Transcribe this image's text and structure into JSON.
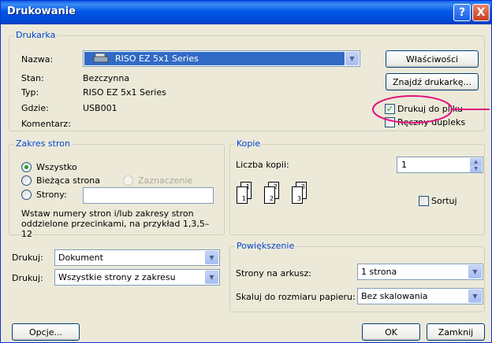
{
  "window": {
    "title": "Drukowanie",
    "help_label": "?",
    "close_label": "X"
  },
  "printer": {
    "group_label": "Drukarka",
    "name_label": "Nazwa:",
    "name_value": "RISO EZ 5x1 Series",
    "status_label": "Stan:",
    "status_value": "Bezczynna",
    "type_label": "Typ:",
    "type_value": "RISO EZ 5x1 Series",
    "where_label": "Gdzie:",
    "where_value": "USB001",
    "comment_label": "Komentarz:",
    "properties_button": "Właściwości",
    "find_button": "Znajdź drukarkę...",
    "print_to_file_label": "Drukuj do pliku",
    "print_to_file_checked": true,
    "manual_duplex_label": "Ręczny dupleks",
    "manual_duplex_checked": false
  },
  "page_range": {
    "group_label": "Zakres stron",
    "all_label": "Wszystko",
    "current_label": "Bieżąca strona",
    "selection_label": "Zaznaczenie",
    "pages_label": "Strony:",
    "pages_value": "",
    "hint": "Wstaw numery stron i/lub zakresy stron oddzielone przecinkami, na przykład 1,3,5–12",
    "selected": "all"
  },
  "copies": {
    "group_label": "Kopie",
    "count_label": "Liczba kopii:",
    "count_value": "1",
    "collate_label": "Sortuj",
    "collate_checked": false,
    "page_numbers": [
      "1",
      "1",
      "2",
      "2",
      "3",
      "3"
    ]
  },
  "print_what": {
    "label": "Drukuj:",
    "value": "Dokument"
  },
  "print_range": {
    "label": "Drukuj:",
    "value": "Wszystkie strony z zakresu"
  },
  "zoom": {
    "group_label": "Powiększenie",
    "pages_per_sheet_label": "Strony na arkusz:",
    "pages_per_sheet_value": "1 strona",
    "scale_label": "Skaluj do rozmiaru papieru:",
    "scale_value": "Bez skalowania"
  },
  "buttons": {
    "options": "Opcje...",
    "ok": "OK",
    "close": "Zamknij"
  },
  "colors": {
    "titlebar": "#0058e6",
    "legend_text": "#0046d5",
    "selection_highlight": "#316ac5",
    "annotation_circle": "#e0137d"
  },
  "annotation": {
    "shape": "ellipse",
    "target": "print_to_file"
  }
}
